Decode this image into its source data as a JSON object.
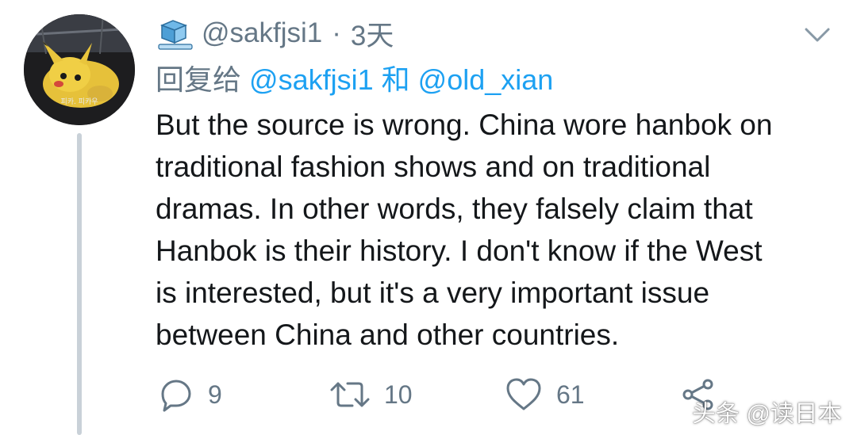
{
  "tweet": {
    "handle": "@sakfjsi1",
    "separator": "·",
    "time": "3天",
    "avatar_caption": "피카. 피카우",
    "reply": {
      "prefix": "回复给",
      "mention1": "@sakfjsi1",
      "conjunction": "和",
      "mention2": "@old_xian"
    },
    "text_lines": [
      "But the source is wrong. China wore hanbok on",
      "traditional fashion shows and on traditional",
      "dramas. In other words, they falsely claim that",
      "Hanbok is their history. I don't know if the West",
      "is interested, but it's a very important issue",
      "between China and other countries."
    ],
    "actions": {
      "reply_count": "9",
      "retweet_count": "10",
      "like_count": "61"
    }
  },
  "watermark": "头条 @读日本",
  "colors": {
    "text_primary": "#14171a",
    "text_secondary": "#657786",
    "link": "#1da1f2",
    "thread_line": "#c9d1d8"
  },
  "icons": [
    "user-icon",
    "chevron-down-icon",
    "reply-icon",
    "retweet-icon",
    "like-icon",
    "share-icon"
  ]
}
